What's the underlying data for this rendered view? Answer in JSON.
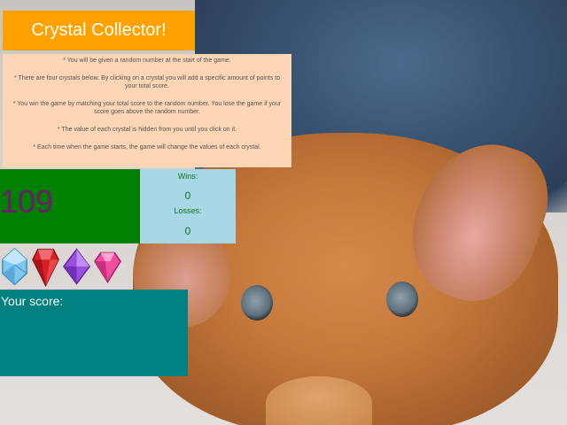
{
  "app": {
    "title": "Crystal Collector!"
  },
  "instructions": [
    "* You will be given a random number at the start of the game.",
    "* There are four crystals below. By clicking on a crystal you will add a specific amount of points to your total score.",
    "* You win the game by matching your total score to the random number. You lose the game if your score goes above the random number.",
    "* The value of each crystal is hidden from you until you click on it.",
    "* Each time when the game starts, the game will change the values of each crystal."
  ],
  "target_number": "109",
  "stats": {
    "wins_label": "Wins:",
    "wins_value": "0",
    "losses_label": "Losses:",
    "losses_value": "0"
  },
  "crystals": [
    {
      "icon": "blue-diamond-crystal-icon",
      "color": "#7ec8f0"
    },
    {
      "icon": "red-ruby-crystal-icon",
      "color": "#d8202a"
    },
    {
      "icon": "purple-amethyst-crystal-icon",
      "color": "#9b4fe0"
    },
    {
      "icon": "pink-crystal-icon",
      "color": "#f04ca0"
    }
  ],
  "score": {
    "label": "Your score:"
  }
}
